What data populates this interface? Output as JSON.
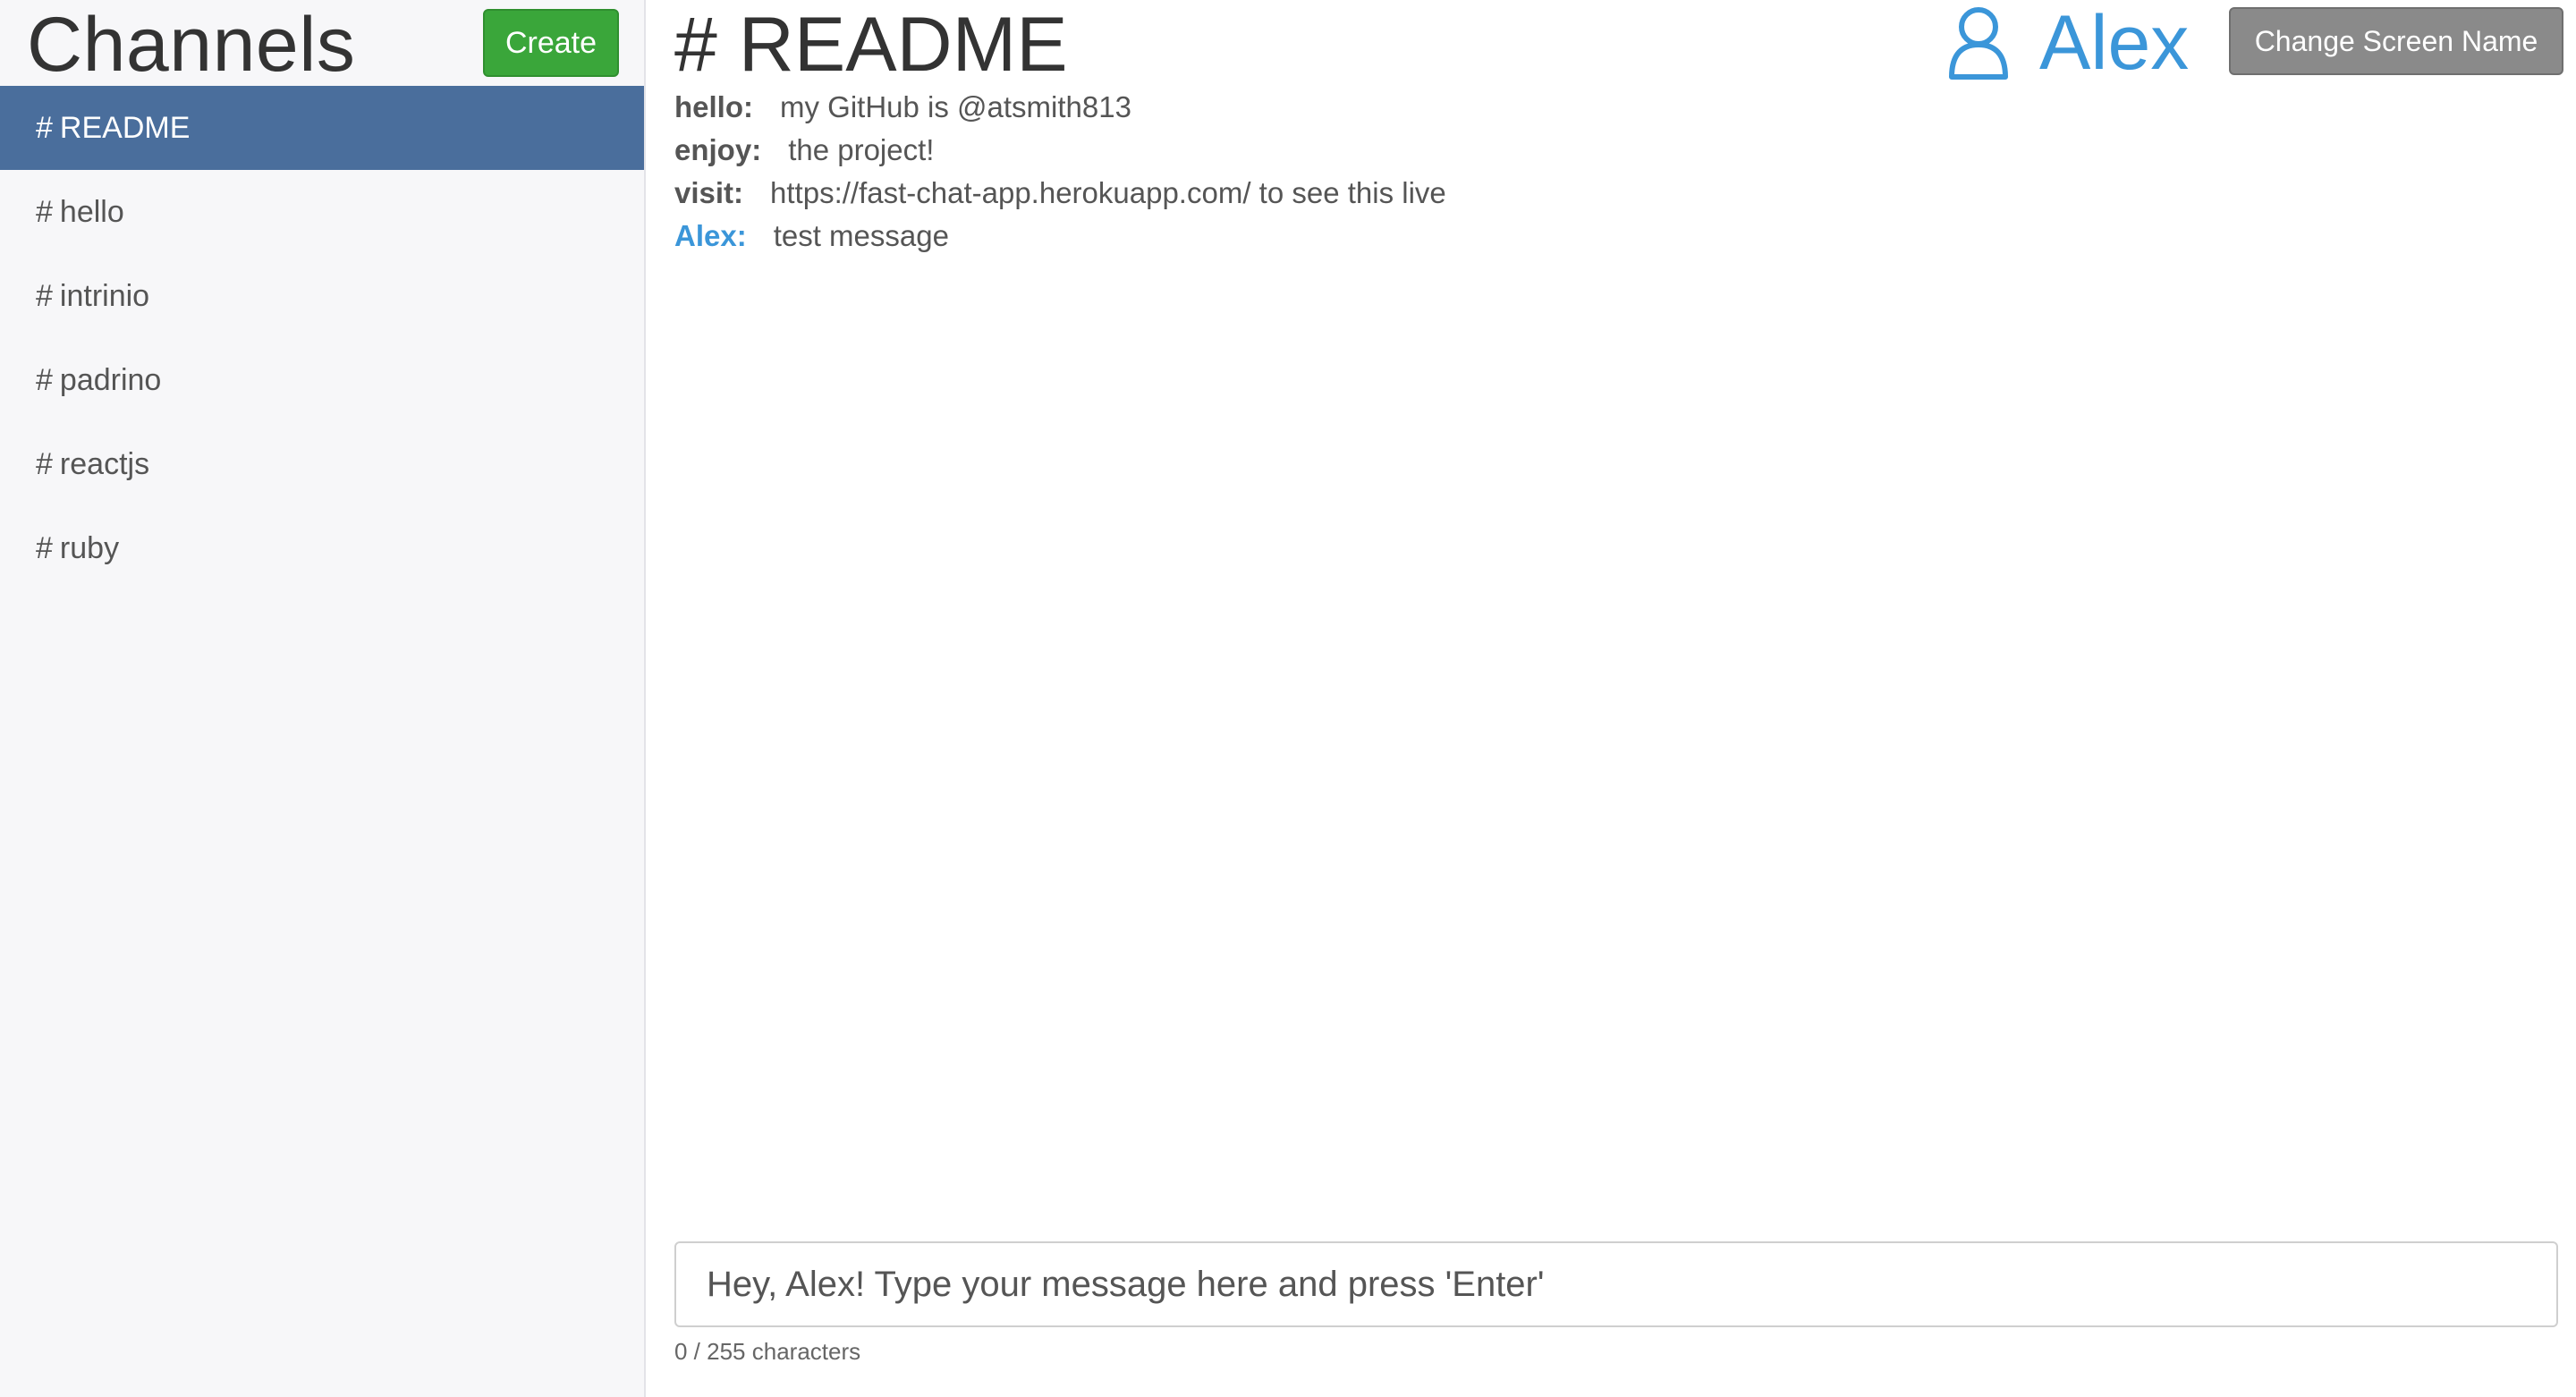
{
  "sidebar": {
    "title": "Channels",
    "create_label": "Create",
    "channels": [
      {
        "hash": "#",
        "name": "README",
        "active": true
      },
      {
        "hash": "#",
        "name": "hello",
        "active": false
      },
      {
        "hash": "#",
        "name": "intrinio",
        "active": false
      },
      {
        "hash": "#",
        "name": "padrino",
        "active": false
      },
      {
        "hash": "#",
        "name": "reactjs",
        "active": false
      },
      {
        "hash": "#",
        "name": "ruby",
        "active": false
      }
    ]
  },
  "header": {
    "channel_title": "# README",
    "user_icon": "user-icon",
    "user_name": "Alex",
    "change_name_label": "Change Screen Name"
  },
  "messages": [
    {
      "author": "hello:",
      "text": "my GitHub is @atsmith813",
      "self": false
    },
    {
      "author": "enjoy:",
      "text": "the project!",
      "self": false
    },
    {
      "author": "visit:",
      "text": "https://fast-chat-app.herokuapp.com/ to see this live",
      "self": false
    },
    {
      "author": "Alex:",
      "text": "test message",
      "self": true
    }
  ],
  "composer": {
    "value": "",
    "placeholder": "Hey, Alex! Type your message here and press 'Enter'",
    "char_count": "0 / 255 characters"
  },
  "colors": {
    "active_channel_bg": "#4a6e9c",
    "create_button": "#3aa63a",
    "accent_blue": "#3b96d9",
    "change_name_button": "#8a8a8a"
  }
}
